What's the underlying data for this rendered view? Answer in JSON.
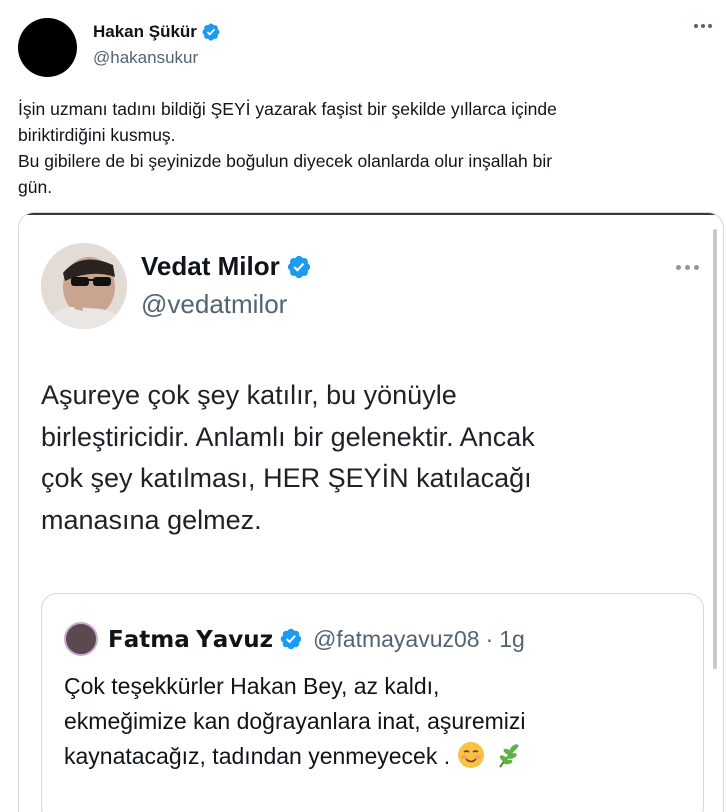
{
  "author": {
    "name": "Hakan Şükür",
    "handle": "@hakansukur",
    "avatar_icon": "avatar-black-circle"
  },
  "tweet": {
    "lines": [
      "İşin uzmanı tadını bildiği ŞEYİ yazarak faşist bir şekilde yıllarca içinde",
      "biriktirdiğini kusmuş.",
      "Bu gibilere de bi şeyinizde boğulun diyecek olanlarda olur inşallah bir",
      "gün."
    ]
  },
  "media": {
    "author": {
      "name": "Vedat Milor",
      "handle": "@vedatmilor"
    },
    "text_lines": [
      "Aşureye çok şey katılır, bu yönüyle",
      "birleştiricidir. Anlamlı bir gelenektir. Ancak",
      "çok şey katılması, HER ŞEYİN katılacağı",
      "manasına gelmez."
    ],
    "quote": {
      "name": "𝗙𝗮𝘁𝗺𝗮 𝗬𝗮𝘃𝘂𝘇",
      "handle": "@fatmayavuz08",
      "separator": "·",
      "time": "1g",
      "text_lines": [
        "Çok teşekkürler Hakan Bey, az kaldı,",
        "ekmeğimize kan doğrayanlara inat, aşuremizi",
        "kaynatacağız, tadından yenmeyecek ."
      ]
    }
  },
  "colors": {
    "verified": "#1d9bf0",
    "secondary_text": "#536471",
    "border": "#cfd9de"
  }
}
